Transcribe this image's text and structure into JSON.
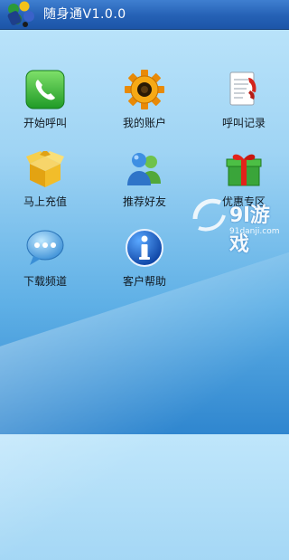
{
  "app": {
    "title": "随身通V1.0.0"
  },
  "menu": {
    "items": [
      {
        "label": "开始呼叫",
        "icon": "phone-icon"
      },
      {
        "label": "我的账户",
        "icon": "gear-icon"
      },
      {
        "label": "呼叫记录",
        "icon": "call-log-icon"
      },
      {
        "label": "马上充值",
        "icon": "box-icon"
      },
      {
        "label": "推荐好友",
        "icon": "contacts-icon"
      },
      {
        "label": "优惠专区",
        "icon": "gift-icon"
      },
      {
        "label": "下载频道",
        "icon": "chat-bubble-icon"
      },
      {
        "label": "客户帮助",
        "icon": "info-icon"
      }
    ]
  },
  "watermark": {
    "brand": "9l游戏",
    "site": "91danji.com"
  },
  "colors": {
    "titlebar": "#2561b5",
    "background_top": "#bfe6fb",
    "background_bottom": "#2f86cf"
  }
}
